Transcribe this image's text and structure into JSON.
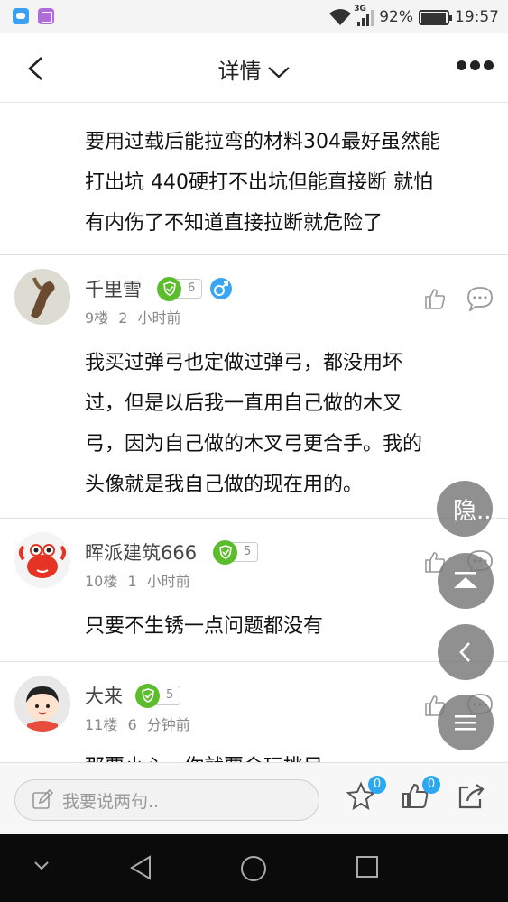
{
  "status_bar": {
    "network": "3G",
    "battery_percent": "92%",
    "time": "19:57",
    "icons": [
      "messages-app-icon",
      "gallery-app-icon",
      "wifi-icon",
      "signal-icon",
      "battery-icon"
    ]
  },
  "navbar": {
    "title": "详情",
    "icons": [
      "back-icon",
      "chevron-down-icon",
      "more-icon"
    ]
  },
  "first_comment_text": [
    "要用过载后能拉弯的材料304最好虽然能",
    "打出坑 440硬打不出坑但能直接断 就怕",
    "有内伤了不知道直接拉断就危险了"
  ],
  "comments": [
    {
      "username": "千里雪",
      "level": "6",
      "gender": "male",
      "floor": "9楼",
      "time": "2 小时前",
      "text": [
        "我买过弹弓也定做过弹弓，都没用坏",
        "过，但是以后我一直用自己做的木叉",
        "弓，因为自己做的木叉弓更合手。我的",
        "头像就是我自己做的现在用的。"
      ]
    },
    {
      "username": "晖派建筑666",
      "level": "5",
      "floor": "10楼",
      "time": "1 小时前",
      "text": [
        "只要不生锈一点问题都没有"
      ]
    },
    {
      "username": "大来",
      "level": "5",
      "floor": "11楼",
      "time": "6 分钟前",
      "text": [
        "那要小心，你就要会玩挑目..."
      ]
    }
  ],
  "floating": {
    "hide_label": "隐...",
    "icons": [
      "scroll-top-icon",
      "back-circle-icon",
      "menu-icon"
    ]
  },
  "input_bar": {
    "placeholder": "我要说两句..",
    "favorite_count": "0",
    "like_count": "0",
    "icons": [
      "edit-icon",
      "star-icon",
      "thumbs-up-icon",
      "share-icon"
    ]
  },
  "colors": {
    "accent_blue": "#2ba8f0",
    "badge_green": "#5bbd2b",
    "male_blue": "#39a6f3",
    "floating_grey": "#787878"
  }
}
